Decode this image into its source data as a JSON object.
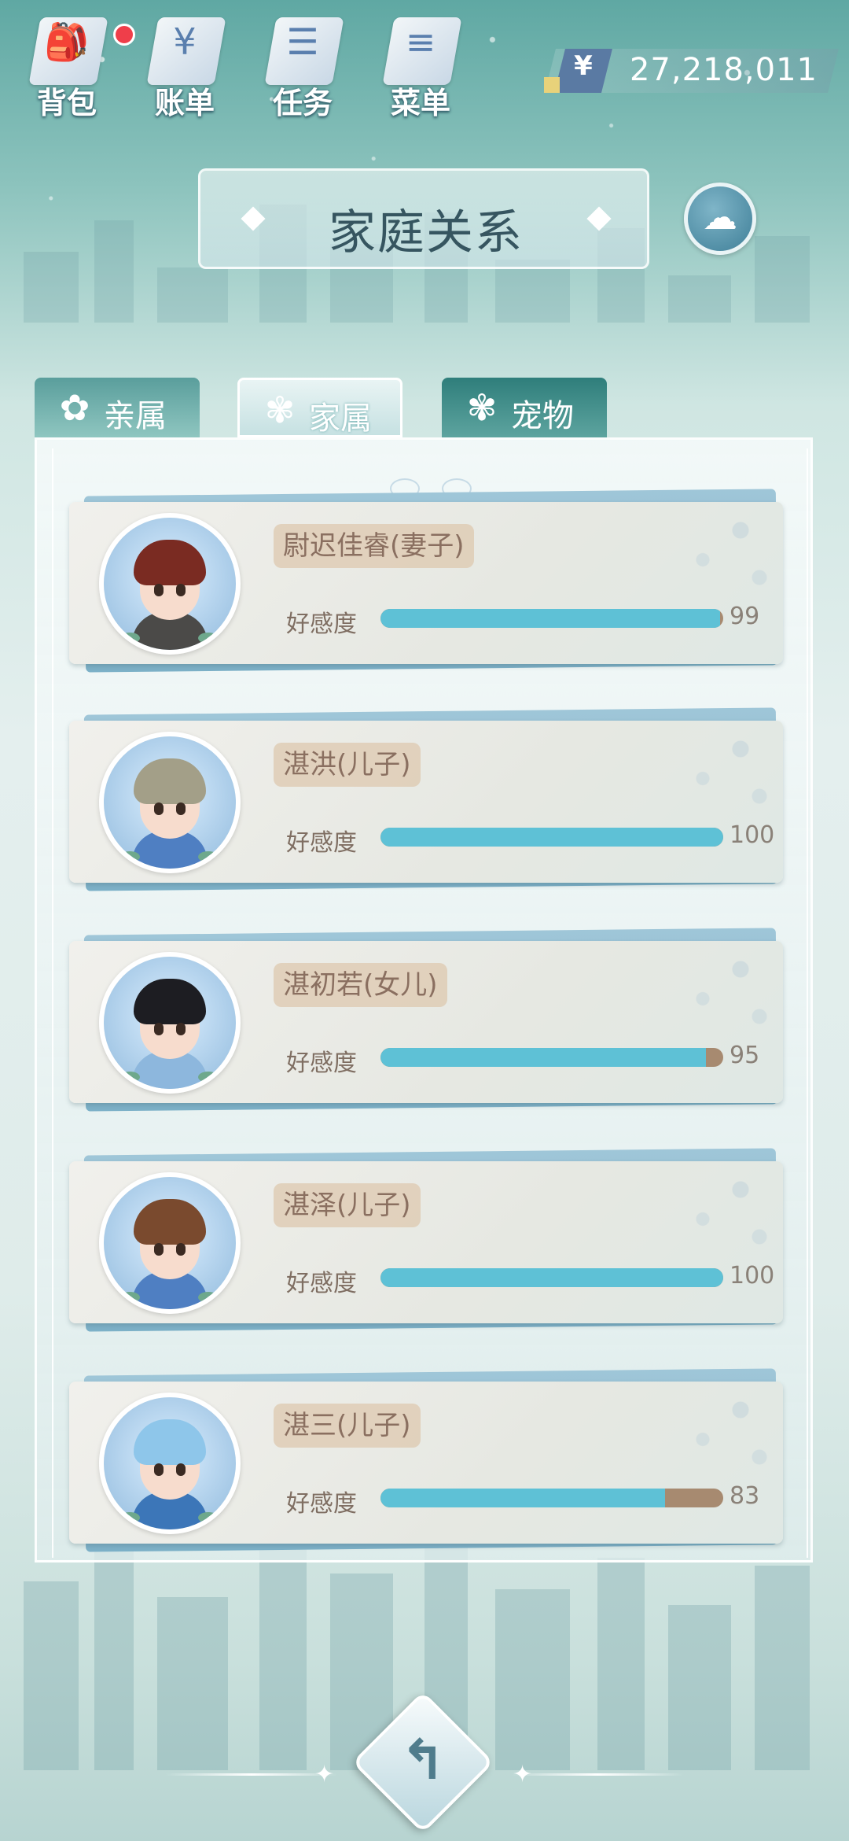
{
  "top_menu": [
    {
      "label": "背包",
      "icon": "backpack-icon",
      "glyph": "🎒",
      "badge": true
    },
    {
      "label": "账单",
      "icon": "bill-icon",
      "glyph": "¥",
      "badge": false
    },
    {
      "label": "任务",
      "icon": "task-list-icon",
      "glyph": "☰",
      "badge": false
    },
    {
      "label": "菜单",
      "icon": "menu-icon",
      "glyph": "≡",
      "badge": false
    }
  ],
  "currency": {
    "symbol": "¥",
    "value": "27,218,011"
  },
  "title": "家庭关系",
  "tabs": [
    {
      "label": "亲属",
      "icon": "blossom-icon",
      "active": false
    },
    {
      "label": "家属",
      "icon": "flower-icon",
      "active": true
    },
    {
      "label": "宠物",
      "icon": "flower-icon",
      "active": false
    }
  ],
  "affection_label": "好感度",
  "members": [
    {
      "name": "尉迟佳睿(妻子)",
      "affection": 99,
      "hair": "#7a2b22",
      "outfit": "#4b4a48"
    },
    {
      "name": "湛洪(儿子)",
      "affection": 100,
      "hair": "#a39f88",
      "outfit": "#4f7fc2"
    },
    {
      "name": "湛初若(女儿)",
      "affection": 95,
      "hair": "#1d1d22",
      "outfit": "#8db7dd"
    },
    {
      "name": "湛泽(儿子)",
      "affection": 100,
      "hair": "#7a4a2e",
      "outfit": "#4f7fc2"
    },
    {
      "name": "湛三(儿子)",
      "affection": 83,
      "hair": "#8ec6ea",
      "outfit": "#3c76b8"
    }
  ],
  "colors": {
    "bar_fill": "#5ec1d6",
    "bar_track": "#a78a70",
    "tab_active": "#e9f4f4"
  }
}
